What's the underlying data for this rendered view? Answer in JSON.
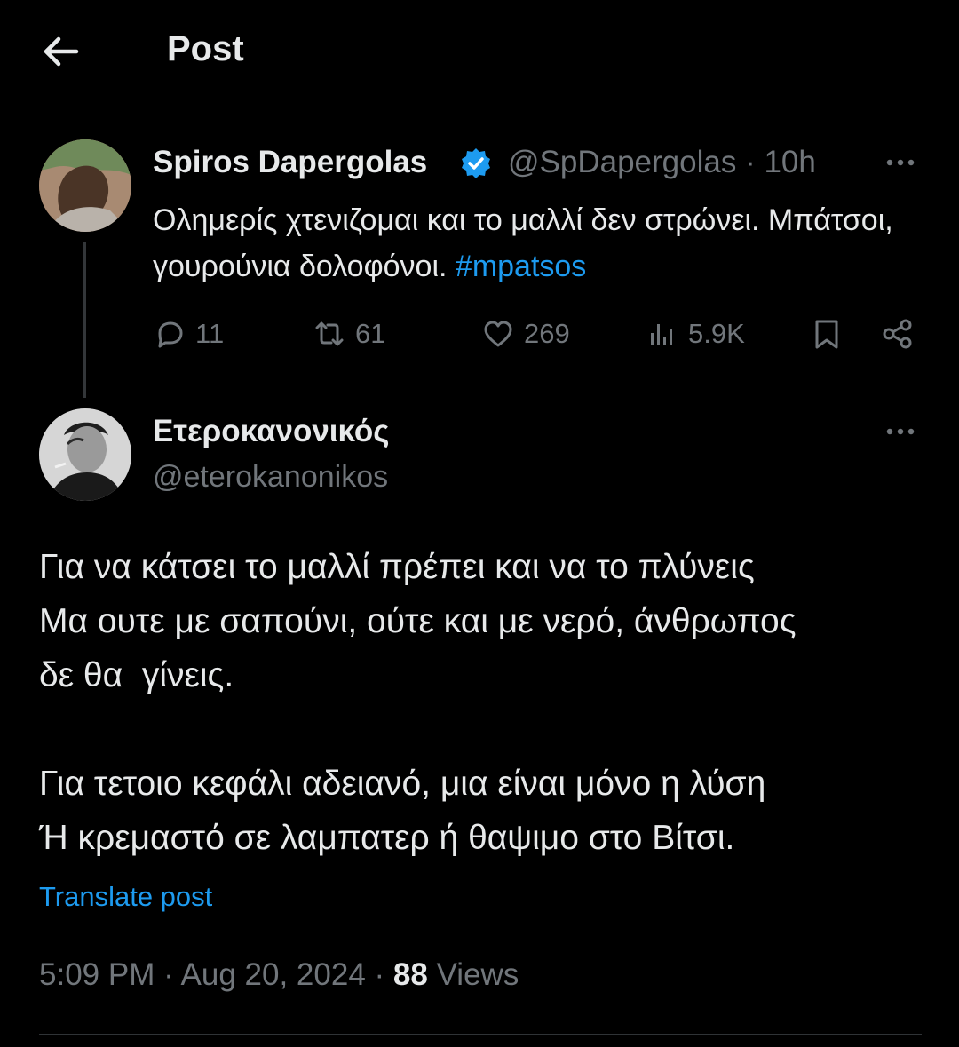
{
  "header": {
    "title": "Post"
  },
  "parent_post": {
    "display_name": "Spiros Dapergolas",
    "handle": "@SpDapergolas",
    "separator": "·",
    "time": "10h",
    "text_before_hashtag": "Ολημερίς χτενιζομαι και το μαλλί δεν στρώνει. Μπάτσοι, γουρούνια δολοφόνοι. ",
    "hashtag": "#mpatsos",
    "replies": "11",
    "reposts": "61",
    "likes": "269",
    "views": "5.9K",
    "accent_color": "#1d9bf0"
  },
  "main_post": {
    "display_name": "Ετεροκανονικός",
    "handle": "@eterokanonikos",
    "body": "Για να κάτσει το μαλλί πρέπει και να το πλύνεις\nΜα ουτε με σαπούνι, ούτε και με νερό, άνθρωπος\nδε θα  γίνεις.\n\nΓια τετοιο κεφάλι αδειανό, μια είναι μόνο η λύση\nΉ κρεμαστό σε λαμπατερ ή θαψιμο στο Βίτσι.",
    "translate_label": "Translate post",
    "time": "5:09 PM",
    "date": "Aug 20, 2024",
    "separator": "·",
    "views_count": "88",
    "views_label": "Views"
  }
}
